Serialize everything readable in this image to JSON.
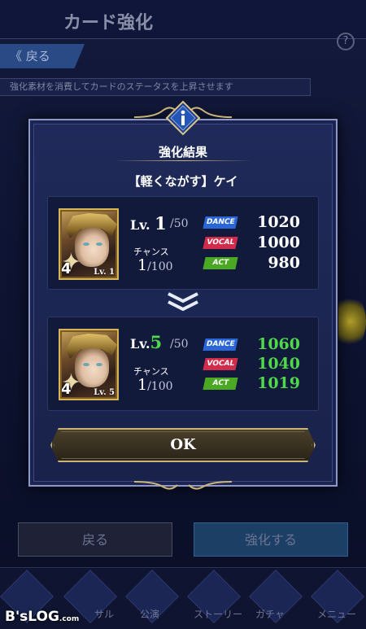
{
  "background": {
    "screen_title": "カード強化",
    "help_icon": "question-mark-icon",
    "back_button_label": "戻る",
    "description": "強化素材を消費してカードのステータスを上昇させます",
    "footer_back_label": "戻る",
    "footer_enhance_label": "強化する",
    "nav_items": [
      "",
      "サル",
      "公演",
      "ストーリー",
      "ガチャ",
      "メニュー"
    ],
    "watermark": {
      "main": "B'sLOG",
      "suffix": ".com"
    }
  },
  "dialog": {
    "icon": "info-icon",
    "title": "強化結果",
    "card_name": "【軽くながす】ケイ",
    "before": {
      "level_prefix": "Lv.",
      "level": "1",
      "level_max": "/50",
      "card_level_tag": "Lv. 1",
      "rarity": "4",
      "chance_label": "チャンス",
      "chance_value": "1",
      "chance_max": "/100",
      "stats": [
        {
          "tag": "DANCE",
          "value": "1020"
        },
        {
          "tag": "VOCAL",
          "value": "1000"
        },
        {
          "tag": "ACT",
          "value": "980"
        }
      ]
    },
    "arrow_icon": "double-chevron-down-icon",
    "after": {
      "level_prefix": "Lv.",
      "level": "5",
      "level_max": "/50",
      "card_level_tag": "Lv. 5",
      "rarity": "4",
      "chance_label": "チャンス",
      "chance_value": "1",
      "chance_max": "/100",
      "stats": [
        {
          "tag": "DANCE",
          "value": "1060"
        },
        {
          "tag": "VOCAL",
          "value": "1040"
        },
        {
          "tag": "ACT",
          "value": "1019"
        }
      ]
    },
    "ok_label": "OK"
  },
  "colors": {
    "dance": "#2a66d8",
    "vocal": "#d22c4c",
    "act": "#4aa823",
    "increase": "#4ed84a",
    "gold_trim": "#c9b47a"
  }
}
